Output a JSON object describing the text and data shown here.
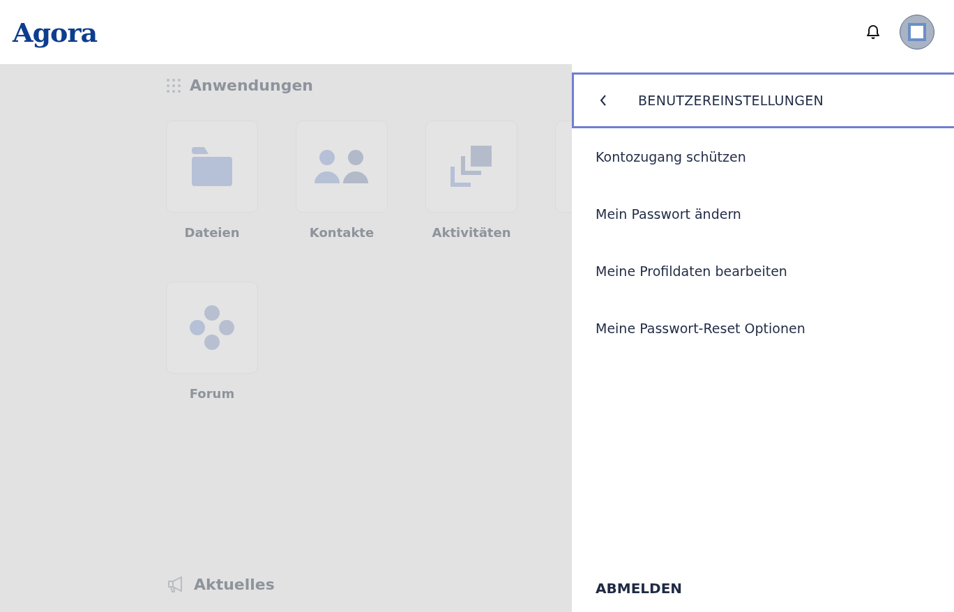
{
  "header": {
    "logo": "Agora"
  },
  "applications": {
    "title": "Anwendungen",
    "apps": [
      {
        "kind": "folder",
        "label": "Dateien"
      },
      {
        "kind": "people",
        "label": "Kontakte"
      },
      {
        "kind": "stack",
        "label": "Aktivitäten"
      },
      {
        "kind": "covered"
      },
      {
        "kind": "dots",
        "label": "Forum"
      }
    ]
  },
  "news": {
    "title": "Aktuelles"
  },
  "settings_panel": {
    "title": "BENUTZEREINSTELLUNGEN",
    "items": [
      "Kontozugang schützen",
      "Mein Passwort ändern",
      "Meine Profildaten bearbeiten",
      "Meine Passwort-Reset Optionen"
    ],
    "logout": "ABMELDEN"
  }
}
